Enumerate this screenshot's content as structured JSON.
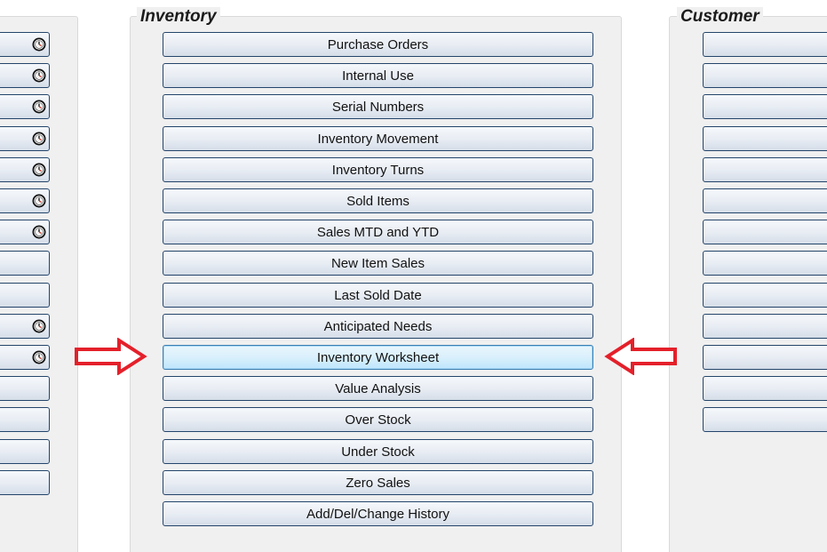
{
  "inventory": {
    "title": "Inventory",
    "buttons": [
      {
        "label": "Purchase Orders"
      },
      {
        "label": "Internal Use"
      },
      {
        "label": "Serial Numbers"
      },
      {
        "label": "Inventory Movement"
      },
      {
        "label": "Inventory Turns"
      },
      {
        "label": "Sold Items"
      },
      {
        "label": "Sales MTD and YTD"
      },
      {
        "label": "New Item Sales"
      },
      {
        "label": "Last Sold Date"
      },
      {
        "label": "Anticipated Needs"
      },
      {
        "label": "Inventory Worksheet",
        "selected": true
      },
      {
        "label": "Value Analysis"
      },
      {
        "label": "Over Stock"
      },
      {
        "label": "Under Stock"
      },
      {
        "label": "Zero Sales"
      },
      {
        "label": "Add/Del/Change History"
      }
    ]
  },
  "customer": {
    "title": "Customer",
    "buttons": 13
  },
  "left_column": {
    "buttons": [
      {
        "icon": "clock-icon"
      },
      {
        "icon": "clock-icon"
      },
      {
        "icon": "clock-icon"
      },
      {
        "icon": "clock-icon"
      },
      {
        "icon": "clock-icon"
      },
      {
        "icon": "clock-icon"
      },
      {
        "icon": "clock-icon"
      },
      {
        "icon": ""
      },
      {
        "icon": ""
      },
      {
        "icon": "clock-icon"
      },
      {
        "icon": "clock-icon"
      },
      {
        "icon": ""
      },
      {
        "icon": ""
      },
      {
        "icon": ""
      },
      {
        "icon": ""
      }
    ]
  },
  "annotations": {
    "arrow_color": "#e4202a",
    "left_arrow_icon": "right-arrow-icon",
    "right_arrow_icon": "left-arrow-icon"
  }
}
